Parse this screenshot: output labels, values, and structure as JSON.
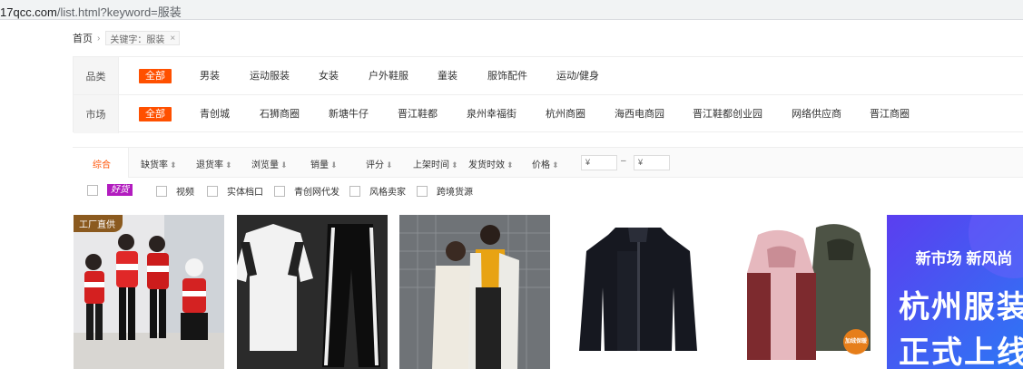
{
  "browser": {
    "url_prefix": "17qcc.com",
    "url_path": "/list.html?keyword=服装"
  },
  "breadcrumb": {
    "home": "首页",
    "separator": "›",
    "keyword_tag": "关键字：服装",
    "remove": "×"
  },
  "filters": {
    "category": {
      "label": "品类",
      "items": [
        "全部",
        "男装",
        "运动服装",
        "女装",
        "户外鞋服",
        "童装",
        "服饰配件",
        "运动/健身"
      ]
    },
    "market": {
      "label": "市场",
      "items": [
        "全部",
        "青创城",
        "石狮商圈",
        "新塘牛仔",
        "晋江鞋都",
        "泉州幸福街",
        "杭州商圈",
        "海西电商园",
        "晋江鞋都创业园",
        "网络供应商",
        "晋江商圈"
      ]
    }
  },
  "sort": {
    "items": [
      "综合",
      "缺货率",
      "退货率",
      "浏览量",
      "销量",
      "评分",
      "上架时间",
      "发货时效",
      "价格"
    ],
    "arrows": [
      "",
      "⬍",
      "⬍",
      "⬇",
      "⬇",
      "⬇",
      "⬍",
      "⬍",
      "⬍"
    ],
    "price_min_placeholder": "¥",
    "price_max_placeholder": "¥",
    "price_dash": "–"
  },
  "options": {
    "hot_badge": "好货",
    "checks": [
      "视频",
      "实体档口",
      "青创网代发",
      "风格卖家",
      "跨境货源"
    ]
  },
  "products": {
    "badge": "工厂直供",
    "promo_line1": "新市场 新风尚",
    "promo_line2": "杭州服装",
    "promo_line3": "正式上线",
    "warm_tag": "加绒保暖"
  },
  "colors": {
    "accent": "#ff5000",
    "hot_badge": "#b21cbf",
    "badge_brown": "#8b5a1f",
    "promo_blue": "#3a5df0"
  }
}
